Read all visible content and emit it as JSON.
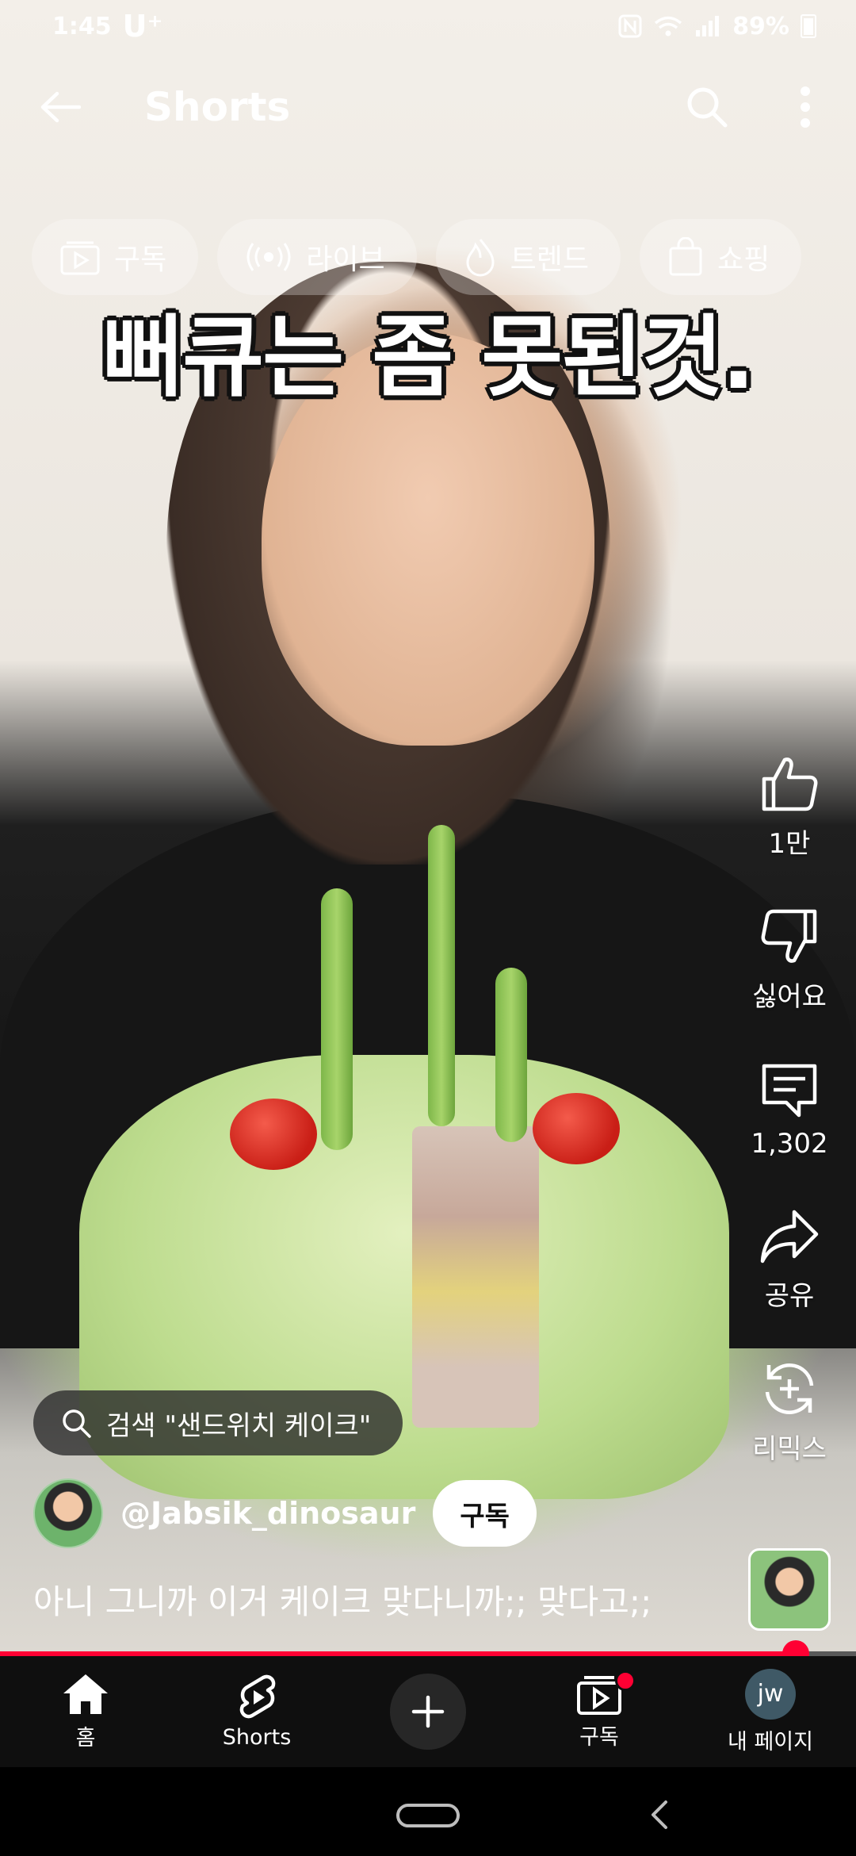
{
  "status_bar": {
    "time": "1:45",
    "carrier": "U⁺",
    "battery": "89%"
  },
  "top_bar": {
    "title": "Shorts"
  },
  "chips": [
    {
      "icon": "subscriptions-icon",
      "label": "구독"
    },
    {
      "icon": "live-icon",
      "label": "라이브"
    },
    {
      "icon": "trending-icon",
      "label": "트렌드"
    },
    {
      "icon": "shopping-bag-icon",
      "label": "쇼핑"
    }
  ],
  "video": {
    "caption": "뻐큐는 좀 못된것."
  },
  "actions": {
    "like_count": "1만",
    "dislike_label": "싫어요",
    "comment_count": "1,302",
    "share_label": "공유",
    "remix_label": "리믹스"
  },
  "search_suggestion": "검색 \"샌드위치 케이크\"",
  "channel": {
    "handle": "@Jabsik_dinosaur",
    "subscribe_label": "구독"
  },
  "description": "아니 그니까 이거 케이크 맞다니까;; 맞다고;;",
  "progress": {
    "fraction": 0.93
  },
  "bottom_nav": [
    {
      "icon": "home-icon",
      "label": "홈"
    },
    {
      "icon": "shorts-icon",
      "label": "Shorts"
    },
    {
      "icon": "create-plus-icon",
      "label": ""
    },
    {
      "icon": "subscriptions-icon",
      "label": "구독"
    },
    {
      "icon": "profile-avatar",
      "label": "내 페이지",
      "initials": "jw"
    }
  ],
  "colors": {
    "accent": "#ff0033",
    "nav_bg": "#0f0f0f"
  }
}
